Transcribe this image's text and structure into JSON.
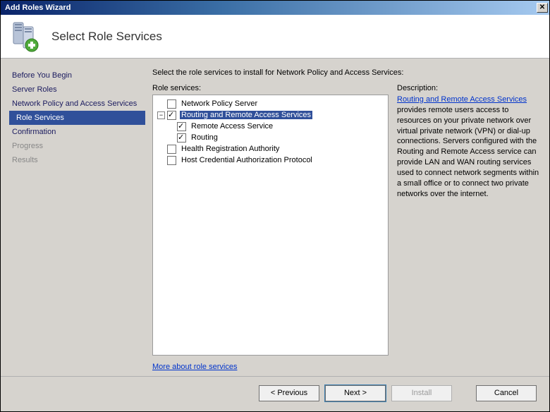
{
  "window": {
    "title": "Add Roles Wizard"
  },
  "header": {
    "title": "Select Role Services"
  },
  "sidebar": {
    "items": [
      {
        "label": "Before You Begin"
      },
      {
        "label": "Server Roles"
      },
      {
        "label": "Network Policy and Access Services"
      },
      {
        "label": "Role Services"
      },
      {
        "label": "Confirmation"
      },
      {
        "label": "Progress"
      },
      {
        "label": "Results"
      }
    ]
  },
  "main": {
    "instruction": "Select the role services to install for Network Policy and Access Services:",
    "rolesLabel": "Role services:",
    "tree": {
      "nps": "Network Policy Server",
      "rras": "Routing and Remote Access Services",
      "ras": "Remote Access Service",
      "routing": "Routing",
      "hra": "Health Registration Authority",
      "hcap": "Host Credential Authorization Protocol"
    },
    "descLabel": "Description:",
    "desc": {
      "link": "Routing and Remote Access Services",
      "body": " provides remote users access to resources on your private network over virtual private network (VPN) or dial-up connections. Servers configured with the Routing and Remote Access service can provide LAN and WAN routing services used to connect network segments within a small office or to connect two private networks over the internet."
    },
    "moreLink": "More about role services"
  },
  "buttons": {
    "previous": "< Previous",
    "next": "Next >",
    "install": "Install",
    "cancel": "Cancel"
  }
}
